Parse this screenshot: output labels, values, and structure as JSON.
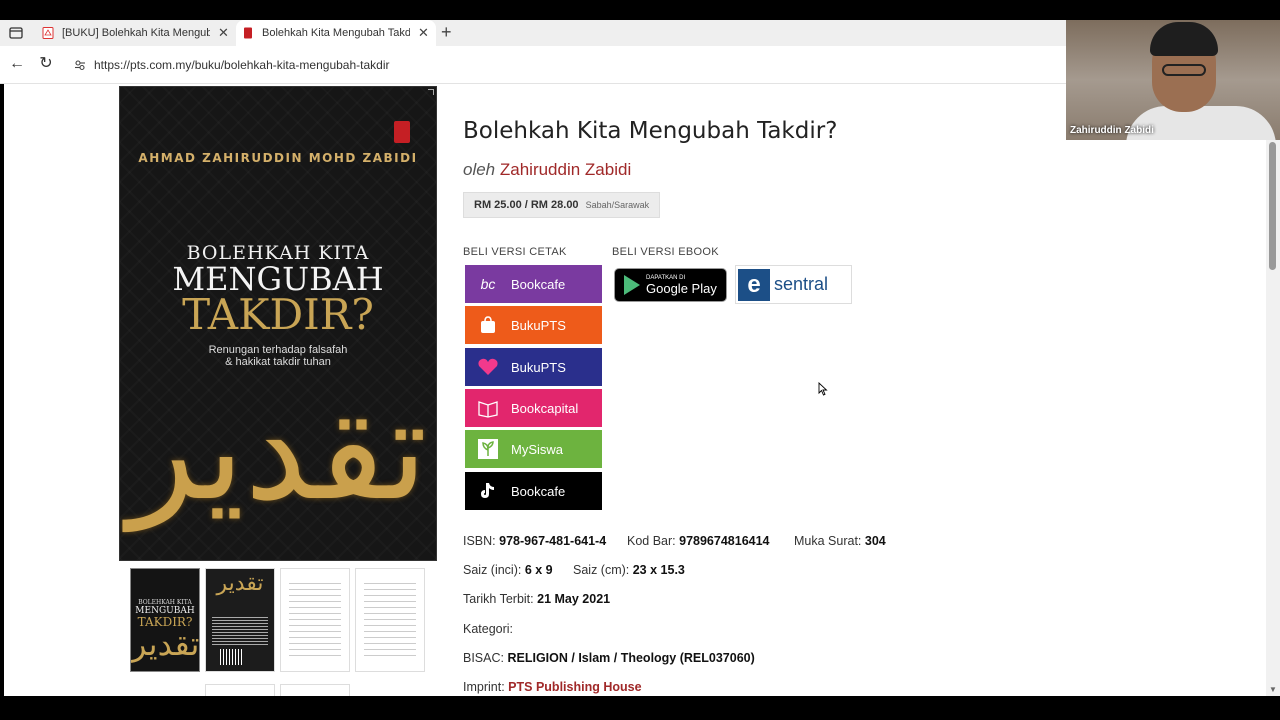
{
  "browser": {
    "tabs": [
      {
        "title": "[BUKU] Bolehkah Kita Mengubah Takdir?",
        "active": false
      },
      {
        "title": "Bolehkah Kita Mengubah Takdir?",
        "active": true
      }
    ],
    "url": "https://pts.com.my/buku/bolehkah-kita-mengubah-takdir"
  },
  "cover": {
    "author": "AHMAD ZAHIRUDDIN MOHD ZABIDI",
    "title_line1": "BOLEHKAH KITA",
    "title_line2": "MENGUBAH",
    "title_line3": "TAKDIR?",
    "subtitle": "Renungan terhadap falsafah\n& hakikat takdir tuhan",
    "calligraphy": "تقدير"
  },
  "book": {
    "title": "Bolehkah Kita Mengubah Takdir?",
    "by_label": "oleh",
    "author": "Zahiruddin Zabidi",
    "price": "RM 25.00 / RM 28.00",
    "price_note": "Sabah/Sarawak"
  },
  "buy": {
    "print_label": "BELI VERSI CETAK",
    "ebook_label": "BELI VERSI EBOOK",
    "print_buttons": [
      {
        "label": "Bookcafe",
        "icon": "bookcafe-icon",
        "color": "#7a3aa0"
      },
      {
        "label": "BukuPTS",
        "icon": "shopee-icon",
        "color": "#ee5b1a"
      },
      {
        "label": "BukuPTS",
        "icon": "lazada-icon",
        "color": "#2a2f8c"
      },
      {
        "label": "Bookcapital",
        "icon": "bookcapital-icon",
        "color": "#e2266d"
      },
      {
        "label": "MySiswa",
        "icon": "mysiswa-icon",
        "color": "#6db33f"
      },
      {
        "label": "Bookcafe",
        "icon": "tiktok-icon",
        "color": "#000000"
      }
    ],
    "google_play_small": "DAPATKAN DI",
    "google_play_big": "Google Play",
    "esentral_word": "sentral"
  },
  "details": {
    "isbn_label": "ISBN:",
    "isbn": "978-967-481-641-4",
    "barcode_label": "Kod Bar:",
    "barcode": "9789674816414",
    "pages_label": "Muka Surat:",
    "pages": "304",
    "size_in_label": "Saiz (inci):",
    "size_in": "6 x 9",
    "size_cm_label": "Saiz (cm):",
    "size_cm": "23 x 15.3",
    "published_label": "Tarikh Terbit:",
    "published": "21 May 2021",
    "category_label": "Kategori:",
    "bisac_label": "BISAC:",
    "bisac": "RELIGION / Islam / Theology (REL037060)",
    "imprint_label": "Imprint:",
    "imprint": "PTS Publishing House"
  },
  "webcam": {
    "name": "Zahiruddin Zabidi"
  }
}
